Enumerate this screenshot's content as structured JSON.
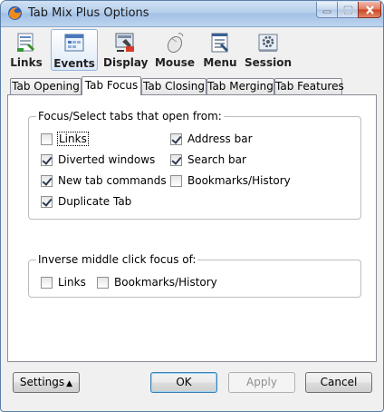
{
  "window": {
    "title": "Tab Mix Plus Options"
  },
  "toolbar": {
    "items": [
      {
        "label": "Links",
        "icon": "links-icon"
      },
      {
        "label": "Events",
        "icon": "events-icon",
        "active": true
      },
      {
        "label": "Display",
        "icon": "display-icon"
      },
      {
        "label": "Mouse",
        "icon": "mouse-icon"
      },
      {
        "label": "Menu",
        "icon": "menu-icon"
      },
      {
        "label": "Session",
        "icon": "session-icon"
      }
    ]
  },
  "tabs": [
    {
      "label": "Tab Opening"
    },
    {
      "label": "Tab Focus",
      "selected": true
    },
    {
      "label": "Tab Closing"
    },
    {
      "label": "Tab Merging"
    },
    {
      "label": "Tab Features"
    }
  ],
  "focus_group": {
    "legend": "Focus/Select tabs that open from:",
    "options": [
      {
        "label": "Links",
        "checked": false
      },
      {
        "label": "Diverted windows",
        "checked": true
      },
      {
        "label": "New tab commands",
        "checked": true
      },
      {
        "label": "Duplicate Tab",
        "checked": true
      },
      {
        "label": "Address bar",
        "checked": true
      },
      {
        "label": "Search bar",
        "checked": true
      },
      {
        "label": "Bookmarks/History",
        "checked": false
      }
    ]
  },
  "inverse_group": {
    "legend": "Inverse middle click focus of:",
    "options": [
      {
        "label": "Links",
        "checked": false
      },
      {
        "label": "Bookmarks/History",
        "checked": false
      }
    ]
  },
  "buttons": {
    "settings": "Settings",
    "ok": "OK",
    "apply": "Apply",
    "cancel": "Cancel"
  },
  "colors": {
    "titlebar": "#b6d0ec",
    "close": "#c9431f",
    "accent": "#3c7fb1"
  }
}
